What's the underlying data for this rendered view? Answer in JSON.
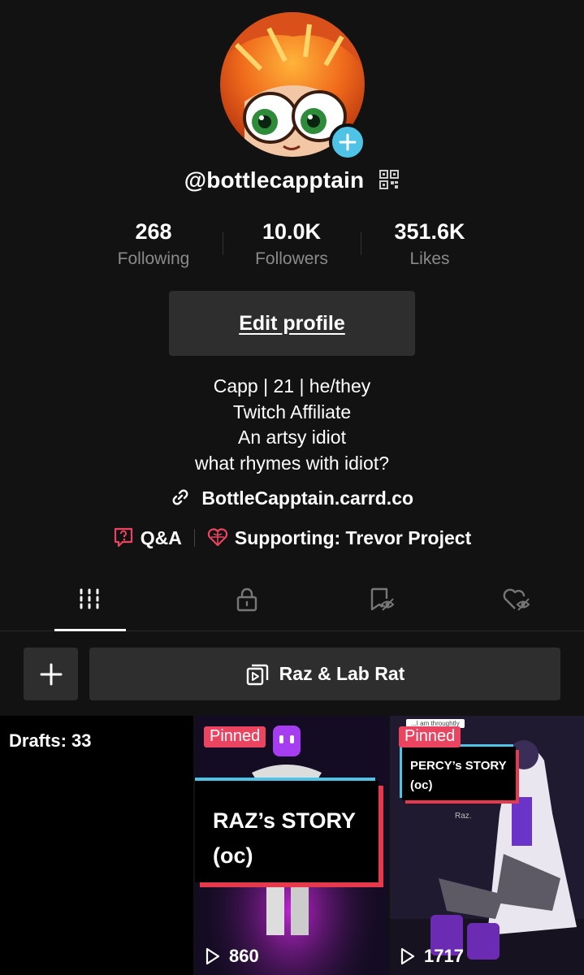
{
  "profile": {
    "username": "@bottlecapptain",
    "stats": [
      {
        "value": "268",
        "label": "Following"
      },
      {
        "value": "10.0K",
        "label": "Followers"
      },
      {
        "value": "351.6K",
        "label": "Likes"
      }
    ],
    "edit_label": "Edit profile",
    "bio": [
      "Capp | 21 | he/they",
      "Twitch Affiliate",
      "An artsy idiot",
      "what rhymes with idiot?"
    ],
    "link": "BottleCapptain.carrd.co",
    "qa_label": "Q&A",
    "supporting_label": "Supporting: Trevor Project"
  },
  "tabs": [
    {
      "icon": "grid-icon",
      "active": true
    },
    {
      "icon": "lock-icon",
      "active": false
    },
    {
      "icon": "hidden-likes-icon",
      "active": false
    },
    {
      "icon": "hidden-heart-icon",
      "active": false
    }
  ],
  "playlist": {
    "label": "Raz & Lab Rat"
  },
  "videos": {
    "drafts_label": "Drafts: 33",
    "items": [
      {
        "pinned": "Pinned",
        "title_line1": "RAZ’s STORY",
        "title_line2": "(oc)",
        "views": "860"
      },
      {
        "pinned": "Pinned",
        "title_line1": "PERCY’s STORY",
        "title_line2": "(oc)",
        "views": "1717",
        "note": "...I am throughtly",
        "tag": "Raz."
      }
    ]
  },
  "colors": {
    "background": "#121212",
    "accent": "#ea4460",
    "plus_badge": "#4fc3e6",
    "button_bg": "#2e2e2e"
  }
}
